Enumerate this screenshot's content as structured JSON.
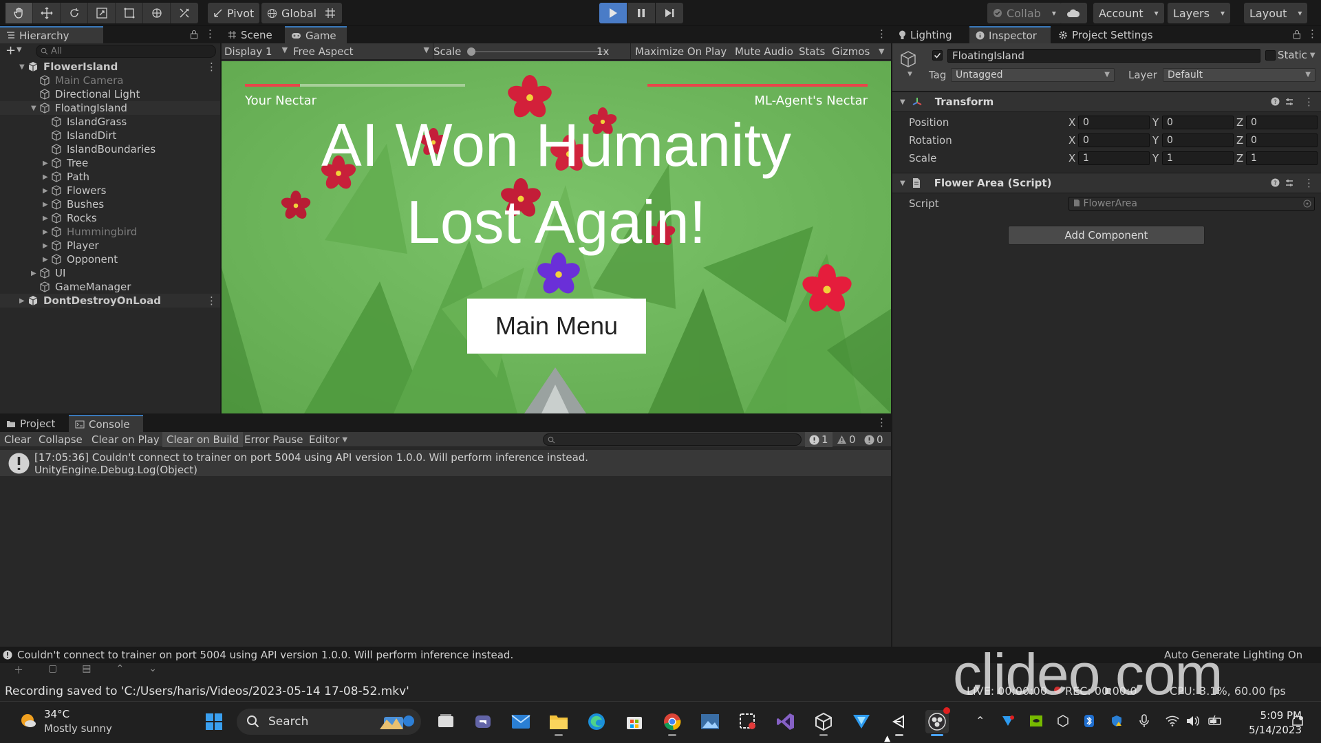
{
  "toolbar": {
    "pivot": "Pivot",
    "global": "Global",
    "collab": "Collab",
    "account": "Account",
    "layers": "Layers",
    "layout": "Layout"
  },
  "hierarchy": {
    "tab": "Hierarchy",
    "search_placeholder": "All",
    "items": [
      {
        "label": "FlowerIsland",
        "depth": 0,
        "kind": "scene",
        "expanded": true
      },
      {
        "label": "Main Camera",
        "depth": 1,
        "kind": "obj",
        "dim": true
      },
      {
        "label": "Directional Light",
        "depth": 1,
        "kind": "obj"
      },
      {
        "label": "FloatingIsland",
        "depth": 1,
        "kind": "obj",
        "expanded": true,
        "selected": true
      },
      {
        "label": "IslandGrass",
        "depth": 2,
        "kind": "obj"
      },
      {
        "label": "IslandDirt",
        "depth": 2,
        "kind": "obj"
      },
      {
        "label": "IslandBoundaries",
        "depth": 2,
        "kind": "obj"
      },
      {
        "label": "Tree",
        "depth": 2,
        "kind": "obj",
        "collapsed": true
      },
      {
        "label": "Path",
        "depth": 2,
        "kind": "obj",
        "collapsed": true
      },
      {
        "label": "Flowers",
        "depth": 2,
        "kind": "obj",
        "collapsed": true
      },
      {
        "label": "Bushes",
        "depth": 2,
        "kind": "obj",
        "collapsed": true
      },
      {
        "label": "Rocks",
        "depth": 2,
        "kind": "obj",
        "collapsed": true
      },
      {
        "label": "Hummingbird",
        "depth": 2,
        "kind": "obj",
        "collapsed": true,
        "dim": true
      },
      {
        "label": "Player",
        "depth": 2,
        "kind": "obj",
        "collapsed": true
      },
      {
        "label": "Opponent",
        "depth": 2,
        "kind": "obj",
        "collapsed": true
      },
      {
        "label": "UI",
        "depth": 1,
        "kind": "obj",
        "collapsed": true
      },
      {
        "label": "GameManager",
        "depth": 1,
        "kind": "obj"
      },
      {
        "label": "DontDestroyOnLoad",
        "depth": 0,
        "kind": "scene",
        "collapsed": true,
        "selected": true
      }
    ]
  },
  "game_view": {
    "tab_scene": "Scene",
    "tab_game": "Game",
    "display": "Display 1",
    "aspect": "Free Aspect",
    "scale_label": "Scale",
    "scale_value": "1x",
    "maximize": "Maximize On Play",
    "mute": "Mute Audio",
    "stats": "Stats",
    "gizmos": "Gizmos",
    "your_nectar": "Your Nectar",
    "agent_nectar": "ML-Agent's Nectar",
    "your_nectar_fill": 0.25,
    "agent_nectar_fill": 1.0,
    "headline_line1": "AI Won Humanity",
    "headline_line2": "Lost Again!",
    "main_menu": "Main Menu"
  },
  "inspector": {
    "tab_lighting": "Lighting",
    "tab_inspector": "Inspector",
    "tab_project_settings": "Project Settings",
    "object_name": "FloatingIsland",
    "static": "Static",
    "tag_label": "Tag",
    "tag_value": "Untagged",
    "layer_label": "Layer",
    "layer_value": "Default",
    "transform_title": "Transform",
    "position_label": "Position",
    "rotation_label": "Rotation",
    "scale_label": "Scale",
    "position": [
      "0",
      "0",
      "0"
    ],
    "rotation": [
      "0",
      "0",
      "0"
    ],
    "scale": [
      "1",
      "1",
      "1"
    ],
    "axis_x": "X",
    "axis_y": "Y",
    "axis_z": "Z",
    "script_component": "Flower Area (Script)",
    "script_label": "Script",
    "script_value": "FlowerArea",
    "add_component": "Add Component"
  },
  "console": {
    "tab_project": "Project",
    "tab_console": "Console",
    "clear": "Clear",
    "collapse": "Collapse",
    "clear_on_play": "Clear on Play",
    "clear_on_build": "Clear on Build",
    "error_pause": "Error Pause",
    "editor": "Editor",
    "count_info": "1",
    "count_warn": "0",
    "count_error": "0",
    "log_line1": "[17:05:36] Couldn't connect to trainer on port 5004 using API version 1.0.0. Will perform inference instead.",
    "log_line2": "UnityEngine.Debug.Log(Object)"
  },
  "status_bar": {
    "message": "Couldn't connect to trainer on port 5004 using API version 1.0.0. Will perform inference instead.",
    "right": "Auto Generate Lighting On"
  },
  "recording": {
    "saved": "Recording saved to 'C:/Users/haris/Videos/2023-05-14 17-08-52.mkv'",
    "live": "LIVE: 00:00:00",
    "rec": "REC: 00:00:0",
    "cpu": "CPU: 3.1%, 60.00 fps"
  },
  "watermark": "clideo.com",
  "taskbar": {
    "temperature": "34°C",
    "weather": "Mostly sunny",
    "search": "Search",
    "time": "5:09 PM",
    "date": "5/14/2023"
  },
  "colors": {
    "accent_blue": "#3a79bb",
    "game_green": "#6db85a",
    "nectar_red": "#e8464a",
    "play_active": "#4a7cc7"
  }
}
